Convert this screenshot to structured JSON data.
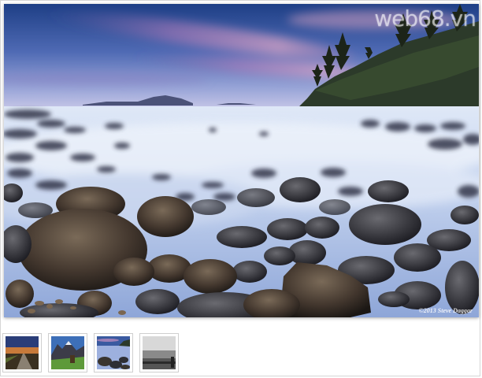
{
  "gallery": {
    "main_image": {
      "alt": "Long-exposure seascape with misty water over round boulders at dusk",
      "watermark": "web68.vn",
      "credit": "©2013 Steve Daggar"
    },
    "thumbnails": [
      {
        "name": "road-sunset"
      },
      {
        "name": "mountain-meadow"
      },
      {
        "name": "misty-rocky-shore"
      },
      {
        "name": "black-white-landscape"
      }
    ]
  }
}
